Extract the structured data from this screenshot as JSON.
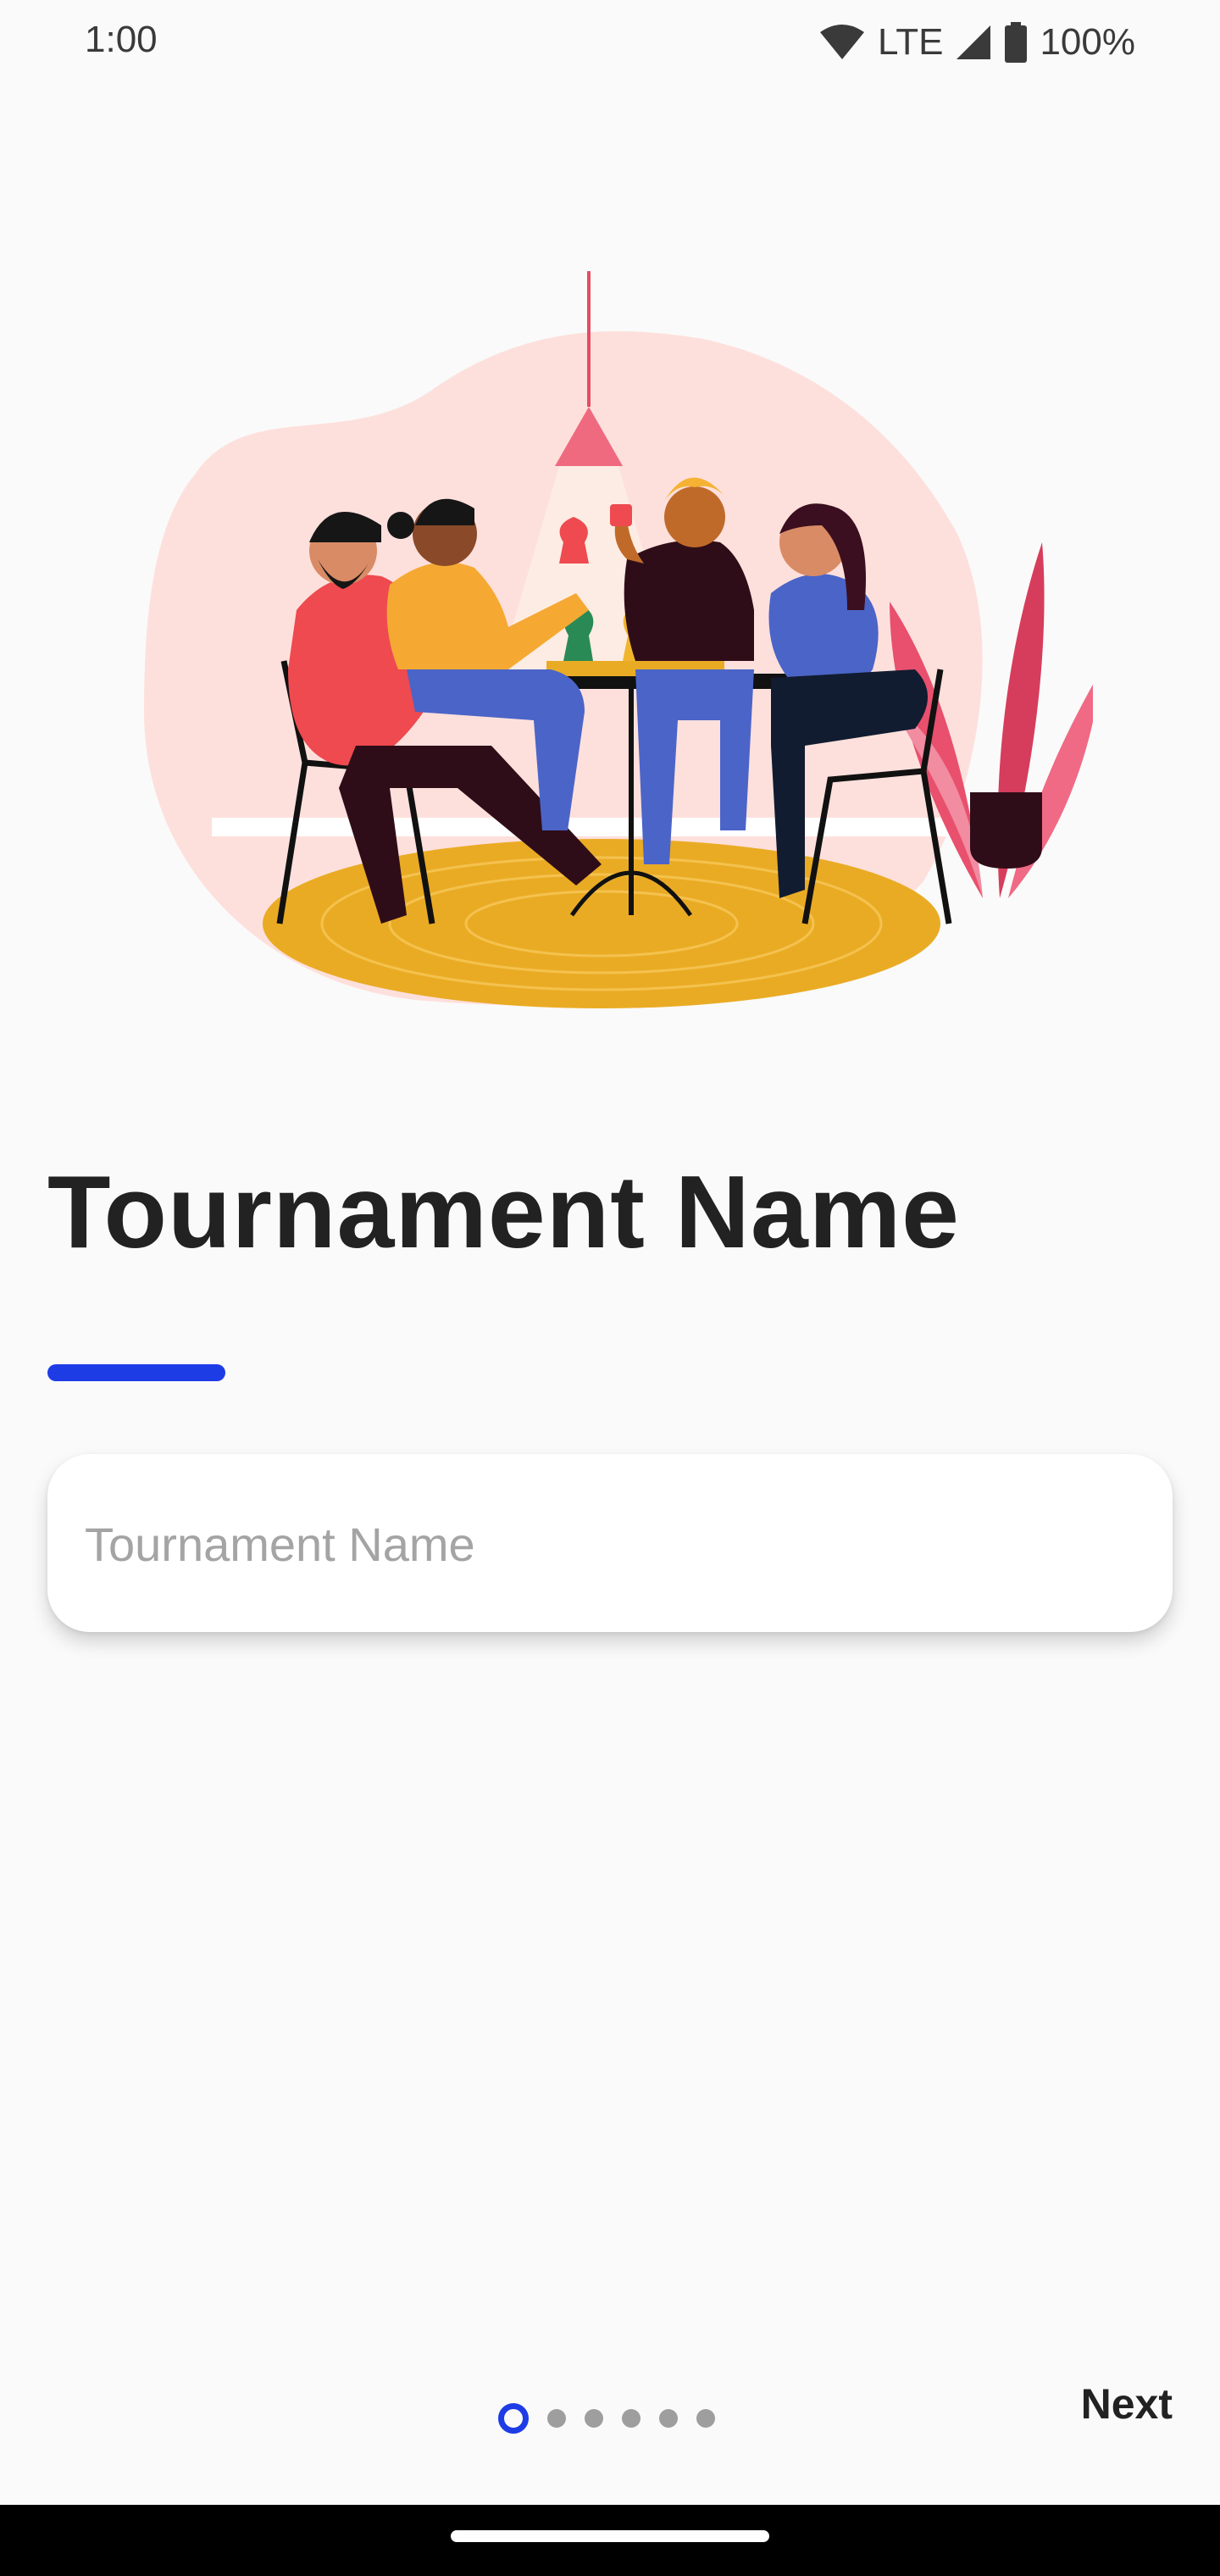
{
  "status_bar": {
    "time": "1:00",
    "network": "LTE",
    "battery": "100%",
    "icons": [
      "wifi-icon",
      "cell-signal-icon",
      "battery-icon"
    ]
  },
  "illustration": {
    "name": "friends-playing-board-game-illustration"
  },
  "page": {
    "title": "Tournament Name"
  },
  "form": {
    "tournament_name_placeholder": "Tournament Name",
    "tournament_name_value": ""
  },
  "pager": {
    "total_pages": 6,
    "current_page": 1
  },
  "actions": {
    "next_label": "Next"
  },
  "colors": {
    "accent": "#1e3ce6",
    "background": "#fafafa",
    "title": "#222222",
    "inactive_dot": "#9e9e9e"
  }
}
